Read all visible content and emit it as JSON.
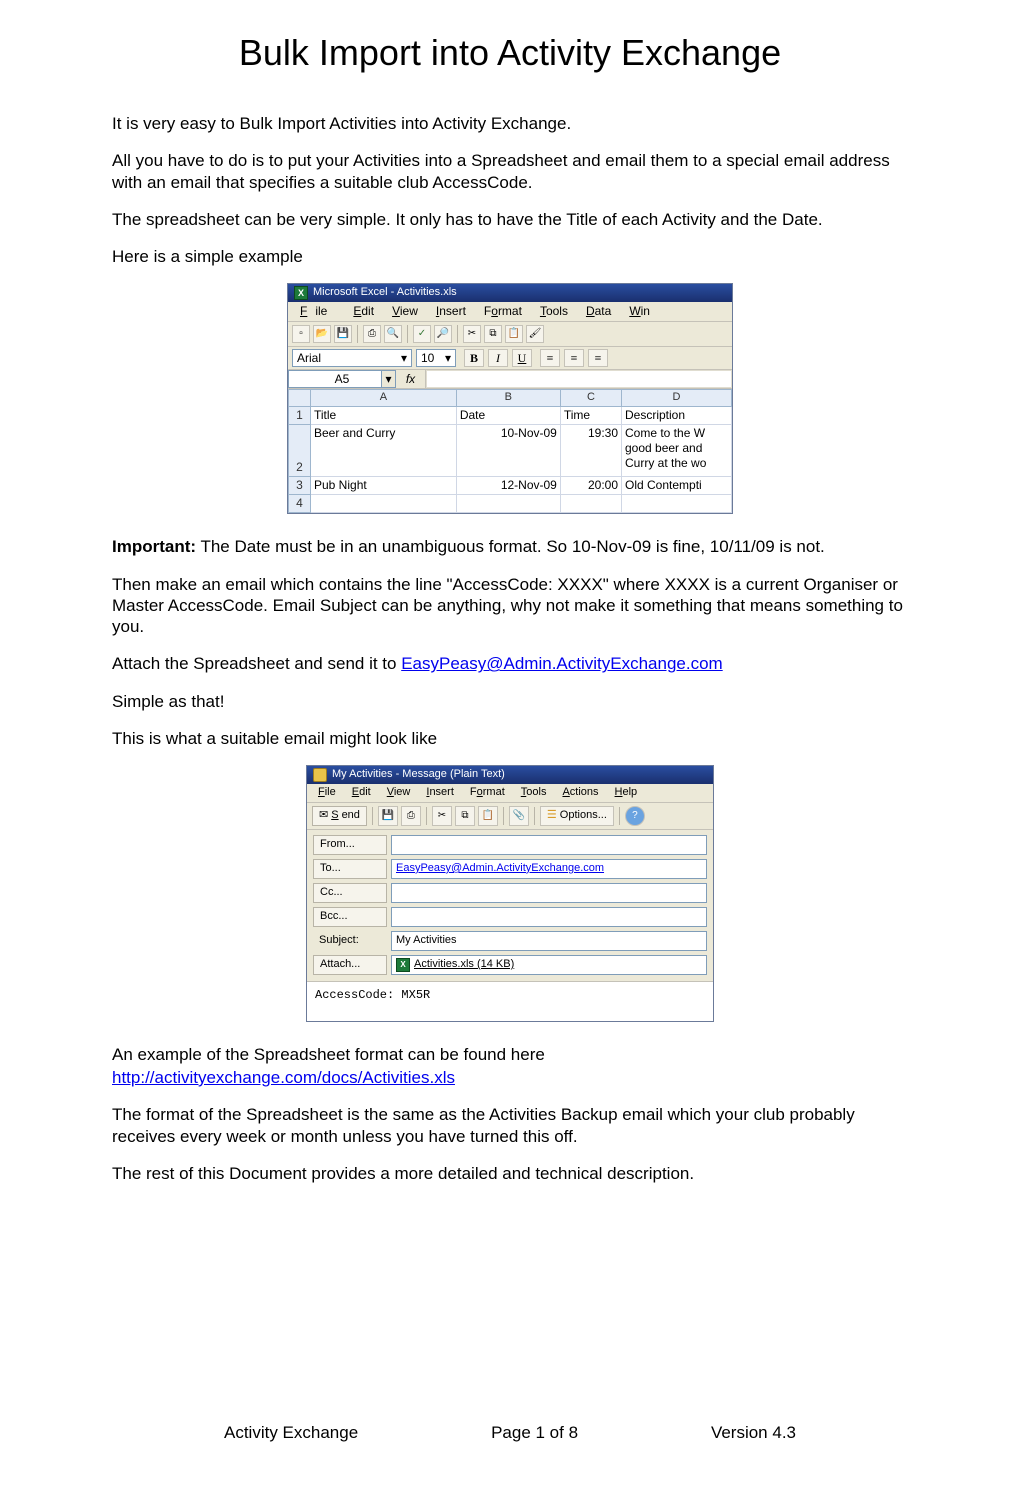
{
  "title": "Bulk Import into Activity Exchange",
  "paragraphs": {
    "p1": "It is very easy to Bulk Import Activities into Activity Exchange.",
    "p2": "All you have to do is to put your Activities into a Spreadsheet and email them to a special email address with an email that specifies a suitable club AccessCode.",
    "p3": "The spreadsheet can be very simple. It only has to have the Title of each Activity and the Date.",
    "p4": "Here is a simple example",
    "important_label": "Important:",
    "important_text": " The Date must be in an unambiguous format. So 10-Nov-09 is fine, 10/11/09 is not.",
    "p5": "Then make an email which contains the line \"AccessCode: XXXX\" where XXXX is a current Organiser or Master AccessCode. Email Subject can be anything, why not make it something that means something to you.",
    "p6_pre": "Attach the Spreadsheet and send it to ",
    "p6_link": "EasyPeasy@Admin.ActivityExchange.com",
    "p7": "Simple as that!",
    "p8": "This is what a suitable email might look like",
    "p9": "An example of the Spreadsheet format can be found here",
    "p9_link": "http://activityexchange.com/docs/Activities.xls",
    "p10": "The format of the Spreadsheet is the same as the Activities Backup email which your club probably receives every week or month unless you have turned this off.",
    "p11": "The rest of this Document provides a more detailed and technical description."
  },
  "excel": {
    "window_title": "Microsoft Excel - Activities.xls",
    "menus": [
      "File",
      "Edit",
      "View",
      "Insert",
      "Format",
      "Tools",
      "Data",
      "Win"
    ],
    "font_name": "Arial",
    "font_size": "10",
    "cell_name": "A5",
    "fx_label": "fx",
    "columns": [
      "A",
      "B",
      "C",
      "D"
    ],
    "headers": {
      "A": "Title",
      "B": "Date",
      "C": "Time",
      "D": "Description"
    },
    "rows": [
      {
        "n": "1"
      },
      {
        "n": "2",
        "A": "Beer and Curry",
        "B": "10-Nov-09",
        "C": "19:30",
        "D": "Come to the W good beer and Curry at the wo"
      },
      {
        "n": "3",
        "A": "Pub Night",
        "B": "12-Nov-09",
        "C": "20:00",
        "D": "Old Contempti"
      },
      {
        "n": "4"
      }
    ]
  },
  "outlook": {
    "window_title": "My Activities - Message (Plain Text)",
    "menus": [
      "File",
      "Edit",
      "View",
      "Insert",
      "Format",
      "Tools",
      "Actions",
      "Help"
    ],
    "send_label": "Send",
    "options_label": "Options...",
    "fields": {
      "from_label": "From...",
      "to_label": "To...",
      "to_value": "EasyPeasy@Admin.ActivityExchange.com",
      "cc_label": "Cc...",
      "bcc_label": "Bcc...",
      "subject_label": "Subject:",
      "subject_value": "My Activities",
      "attach_label": "Attach...",
      "attach_value": "Activities.xls (14 KB)"
    },
    "body": "AccessCode: MX5R"
  },
  "footer": {
    "left": "Activity Exchange",
    "center": "Page 1 of 8",
    "right": "Version 4.3"
  }
}
